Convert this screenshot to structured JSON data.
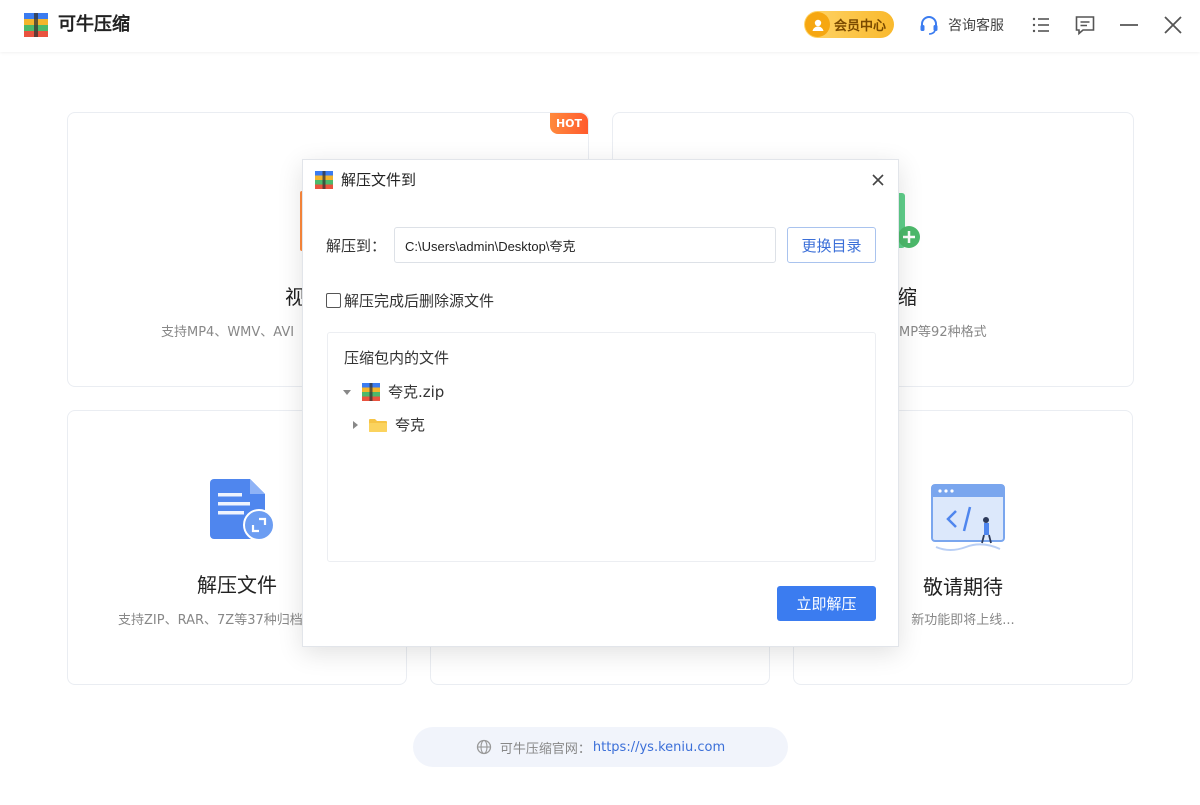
{
  "app": {
    "title": "可牛压缩"
  },
  "titlebar": {
    "vip_label": "会员中心",
    "service_label": "咨询客服",
    "icons": [
      "menu-list-icon",
      "feedback-icon",
      "minimize-icon",
      "close-icon"
    ]
  },
  "cards": {
    "video": {
      "title_partial": "视",
      "desc_partial": "支持MP4、WMV、AVI",
      "badge": "HOT"
    },
    "image": {
      "title_partial": "缩",
      "desc_partial": "MP等92种格式"
    },
    "extract": {
      "title": "解压文件",
      "desc": "支持ZIP、RAR、7Z等37种归档"
    },
    "coming": {
      "title": "敬请期待",
      "desc": "新功能即将上线..."
    }
  },
  "footer": {
    "label": "可牛压缩官网：",
    "link": "https://ys.keniu.com"
  },
  "dialog": {
    "title": "解压文件到",
    "path_label": "解压到：",
    "path_value": "C:\\Users\\admin\\Desktop\\夸克",
    "change_dir_button": "更换目录",
    "delete_after_label": "解压完成后删除源文件",
    "delete_after_checked": false,
    "files_heading": "压缩包内的文件",
    "tree": [
      {
        "name": "夸克.zip",
        "type": "archive",
        "expanded": true
      },
      {
        "name": "夸克",
        "type": "folder",
        "expanded": false
      }
    ],
    "extract_button": "立即解压"
  },
  "colors": {
    "accent": "#3b7cf0",
    "link": "#3b6fd8",
    "vip": "#f9b92d",
    "hot": "#ff5b2e"
  }
}
